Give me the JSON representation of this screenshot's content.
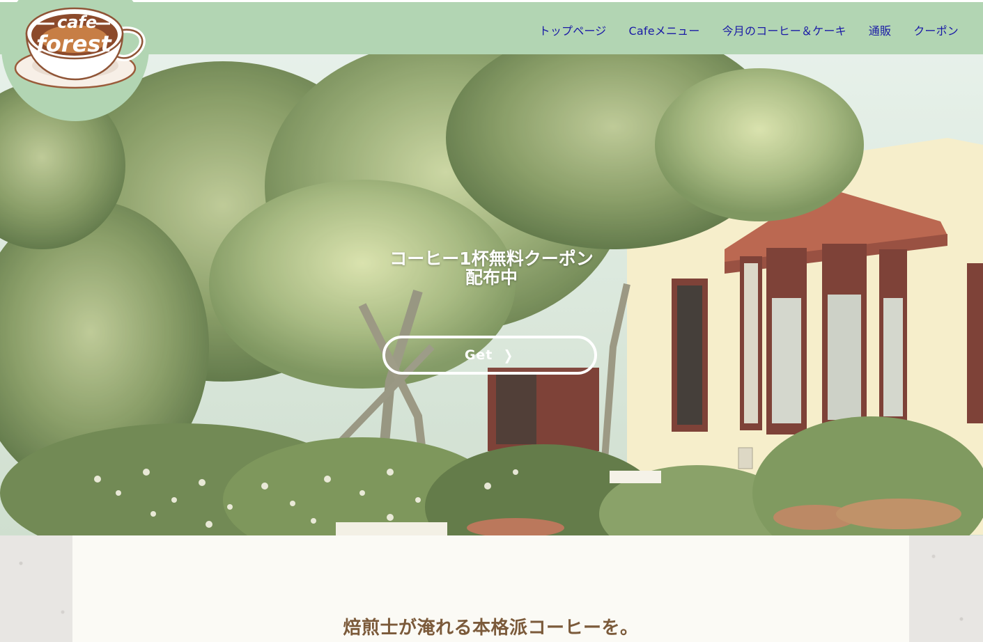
{
  "brand": {
    "logo_line1": "cafe",
    "logo_line2": "forest"
  },
  "nav": {
    "items": [
      {
        "label": "トップページ"
      },
      {
        "label": "Cafeメニュー"
      },
      {
        "label": "今月のコーヒー＆ケーキ"
      },
      {
        "label": "通販"
      },
      {
        "label": "クーポン"
      }
    ]
  },
  "hero": {
    "title_line1": "コーヒー1杯無料クーポン",
    "title_line2": "配布中",
    "button_label": "Get"
  },
  "main": {
    "lead": "焙煎士が淹れる本格派コーヒーを。"
  },
  "colors": {
    "header": "#b2d5b3",
    "nav_text": "#1a1aa6",
    "lead_text": "#7b5a3a",
    "panel_bg": "#fbfaf5"
  },
  "icons": [
    "coffee-cup-logo-icon",
    "chevron-right-icon"
  ]
}
